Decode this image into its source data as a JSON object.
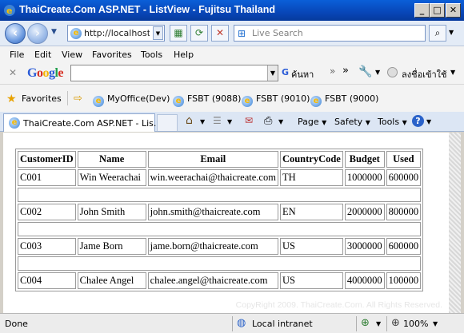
{
  "window": {
    "title": "ThaiCreate.Com ASP.NET - ListView - Fujitsu Thailand"
  },
  "address_bar": {
    "url": "http://localhost/",
    "search_placeholder": "Live Search"
  },
  "menu": [
    "File",
    "Edit",
    "View",
    "Favorites",
    "Tools",
    "Help"
  ],
  "google_toolbar": {
    "logo": "Google",
    "search_label": "ค้นหา",
    "signin": "ลงชื่อเข้าใช้"
  },
  "favorites_bar": {
    "label": "Favorites",
    "items": [
      "MyOffice(Dev)",
      "FSBT (9088)",
      "FSBT (9010)",
      "FSBT (9000)"
    ]
  },
  "tab": {
    "title": "ThaiCreate.Com ASP.NET - Lis..."
  },
  "command_bar": {
    "page": "Page",
    "safety": "Safety",
    "tools": "Tools"
  },
  "table": {
    "headers": [
      "CustomerID",
      "Name",
      "Email",
      "CountryCode",
      "Budget",
      "Used"
    ],
    "rows": [
      [
        "C001",
        "Win Weerachai",
        "win.weerachai@thaicreate.com",
        "TH",
        "1000000",
        "600000"
      ],
      [
        "C002",
        "John Smith",
        "john.smith@thaicreate.com",
        "EN",
        "2000000",
        "800000"
      ],
      [
        "C003",
        "Jame Born",
        "jame.born@thaicreate.com",
        "US",
        "3000000",
        "600000"
      ],
      [
        "C004",
        "Chalee Angel",
        "chalee.angel@thaicreate.com",
        "US",
        "4000000",
        "100000"
      ]
    ]
  },
  "watermark": "CopyRight 2009. ThaiCreate.Com. All Rights Reserved.",
  "status": {
    "left": "Done",
    "zone": "Local intranet",
    "zoom": "100%"
  }
}
